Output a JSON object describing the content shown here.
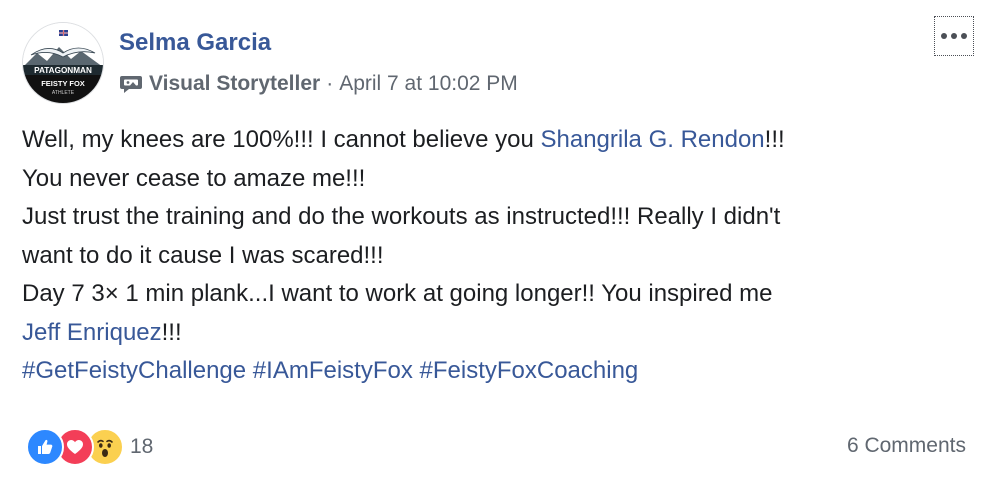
{
  "post": {
    "author": "Selma Garcia",
    "avatar": {
      "brand_top": "PATAGONMAN",
      "brand_bottom": "FEISTY FOX",
      "brand_sub": "ATHLETE"
    },
    "badge": "Visual Storyteller",
    "separator": "·",
    "timestamp": "April 7 at 10:02 PM",
    "body": {
      "l1_text": "Well, my knees are 100%!!! I cannot believe you ",
      "l1_mention": "Shangrila G. Rendon",
      "l1_tail": "!!!",
      "l2": "You never cease to amaze me!!!",
      "l3": "Just trust the training and do the workouts as instructed!!! Really I didn't",
      "l4": "want to do it cause I was scared!!!",
      "l5": "Day 7 3× 1 min plank...I want to work at going longer!! You inspired me",
      "l6_mention": "Jeff Enriquez",
      "l6_tail": "!!!",
      "hashtags": [
        "#GetFeistyChallenge",
        "#IAmFeistyFox",
        "#FeistyFoxCoaching"
      ]
    },
    "reactions": {
      "types": [
        "like-icon",
        "love-icon",
        "wow-icon"
      ],
      "count": "18"
    },
    "comments": "6 Comments"
  },
  "colors": {
    "link": "#385898",
    "text": "#1c1e21",
    "meta": "#606770",
    "like": "#2d88ff",
    "love": "#f33e58",
    "wow": "#fbd050"
  }
}
